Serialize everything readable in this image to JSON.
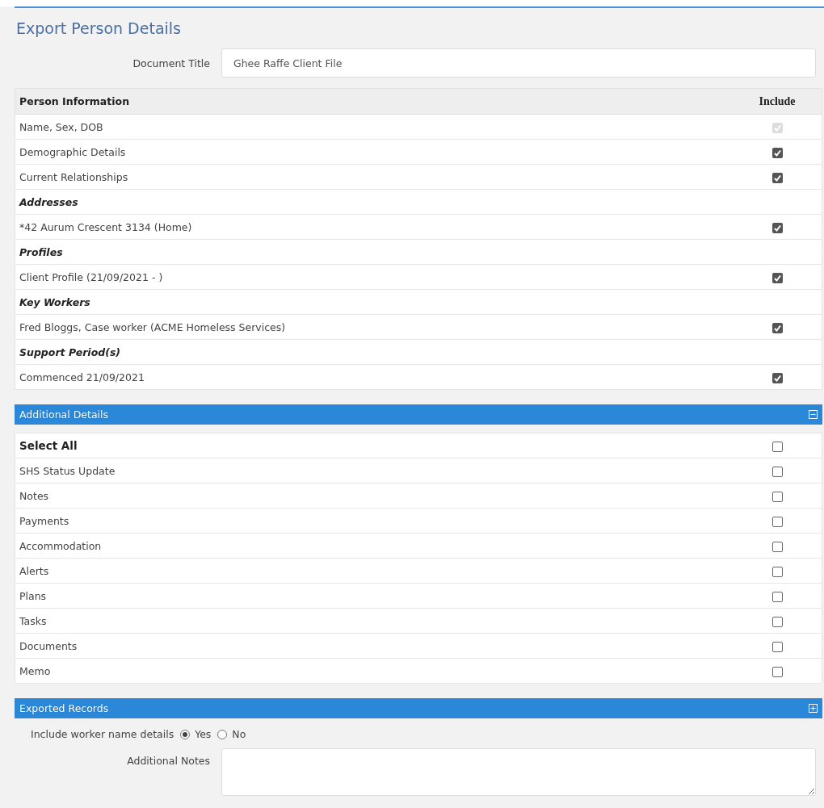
{
  "title": "Export Person Details",
  "document_title": {
    "label": "Document Title",
    "value": "Ghee Raffe Client File"
  },
  "person_information": {
    "columns": [
      "Person Information",
      "Include"
    ],
    "rows": [
      {
        "kind": "item",
        "label": "Name, Sex, DOB",
        "checked": true,
        "disabled": true
      },
      {
        "kind": "item",
        "label": "Demographic Details",
        "checked": true,
        "disabled": false
      },
      {
        "kind": "item",
        "label": "Current Relationships",
        "checked": true,
        "disabled": false
      },
      {
        "kind": "group",
        "label": "Addresses"
      },
      {
        "kind": "item",
        "label": "*42 Aurum Crescent 3134 (Home)",
        "checked": true,
        "disabled": false
      },
      {
        "kind": "group",
        "label": "Profiles"
      },
      {
        "kind": "item",
        "label": "Client Profile (21/09/2021 - )",
        "checked": true,
        "disabled": false
      },
      {
        "kind": "group",
        "label": "Key Workers"
      },
      {
        "kind": "item",
        "label": "Fred Bloggs, Case worker (ACME Homeless Services)",
        "checked": true,
        "disabled": false
      },
      {
        "kind": "group",
        "label": "Support Period(s)"
      },
      {
        "kind": "item",
        "label": "Commenced 21/09/2021",
        "checked": true,
        "disabled": false
      }
    ]
  },
  "additional_details": {
    "title": "Additional Details",
    "expanded": true,
    "rows": [
      {
        "kind": "select_all",
        "label": "Select All",
        "checked": false
      },
      {
        "kind": "item",
        "label": "SHS Status Update",
        "checked": false
      },
      {
        "kind": "item",
        "label": "Notes",
        "checked": false
      },
      {
        "kind": "item",
        "label": "Payments",
        "checked": false
      },
      {
        "kind": "item",
        "label": "Accommodation",
        "checked": false
      },
      {
        "kind": "item",
        "label": "Alerts",
        "checked": false
      },
      {
        "kind": "item",
        "label": "Plans",
        "checked": false
      },
      {
        "kind": "item",
        "label": "Tasks",
        "checked": false
      },
      {
        "kind": "item",
        "label": "Documents",
        "checked": false
      },
      {
        "kind": "item",
        "label": "Memo",
        "checked": false
      }
    ]
  },
  "exported_records": {
    "title": "Exported Records",
    "expanded": false,
    "worker_name": {
      "label": "Include worker name details",
      "options": [
        {
          "label": "Yes",
          "selected": true
        },
        {
          "label": "No",
          "selected": false
        }
      ]
    },
    "notes": {
      "label": "Additional Notes"
    }
  }
}
